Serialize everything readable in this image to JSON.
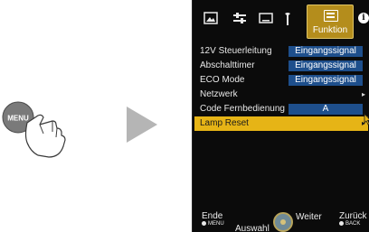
{
  "left": {
    "menu_button_label": "MENU",
    "colors": {
      "menu_button": "#7a7a7a",
      "arrow": "#b5b5b5"
    }
  },
  "osd": {
    "tabs": [
      {
        "icon": "picture-icon"
      },
      {
        "icon": "settings-sliders-icon"
      },
      {
        "icon": "input-signal-icon"
      },
      {
        "icon": "installation-icon"
      },
      {
        "icon": "function-icon",
        "label": "Funktion",
        "active": true
      },
      {
        "icon": "info-icon"
      }
    ],
    "rows": [
      {
        "label": "12V Steuerleitung",
        "value": "Eingangssignal"
      },
      {
        "label": "Abschalttimer",
        "value": "Eingangssignal"
      },
      {
        "label": "ECO Mode",
        "value": "Eingangssignal"
      },
      {
        "label": "Netzwerk",
        "chevron": "▸"
      },
      {
        "label": "Code Fernbedienung",
        "value": "A"
      },
      {
        "label": "Lamp Reset",
        "chevron": "▸",
        "selected": true
      }
    ],
    "bottom": {
      "exit_label": "Ende",
      "exit_key": "MENU",
      "select_label": "Auswahl",
      "next_label": "Weiter",
      "back_label": "Zurück",
      "back_key": "BACK"
    },
    "colors": {
      "panel_bg": "#0b0b0b",
      "value_bg": "#1e4f8c",
      "selected_row": "#e6b416",
      "active_tab": "#b48d1c"
    }
  }
}
